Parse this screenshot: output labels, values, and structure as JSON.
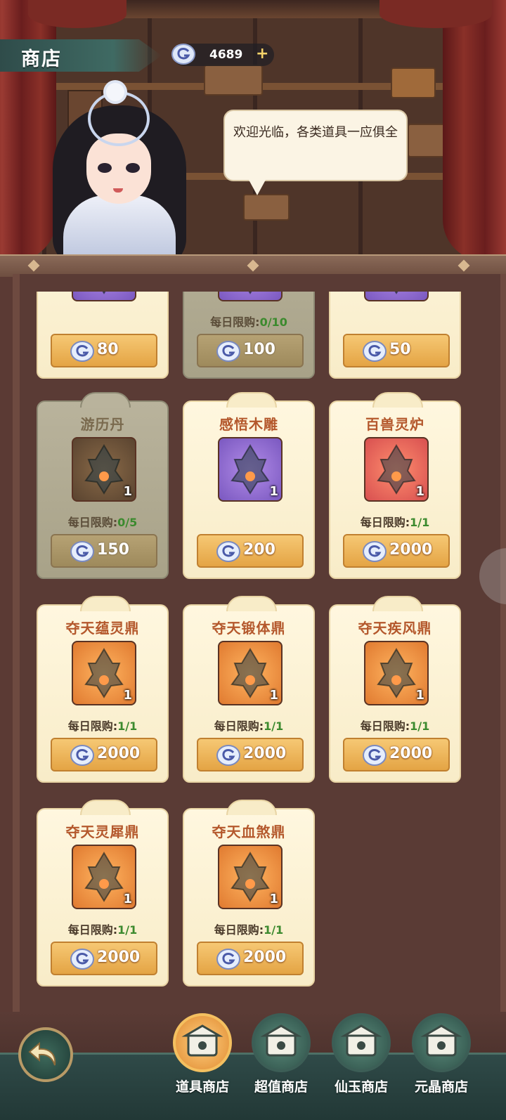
{
  "header": {
    "title": "商店",
    "currency_value": "4689",
    "currency_plus": "+",
    "currency_icon": "spirit-stone-icon"
  },
  "npc": {
    "greeting": "欢迎光临，各类道具一应俱全"
  },
  "colors": {
    "card_bg": "#f8ecc8",
    "price_bg": "#e4a444",
    "limit_green": "#3c8a2e",
    "name_orange": "#b4582c",
    "nav_bg": "#223836"
  },
  "items": [
    {
      "name": "",
      "limit_label": "",
      "limit_value": "",
      "price": "80",
      "qty": "",
      "icon": "potion-icon",
      "sold_out": false
    },
    {
      "name": "",
      "limit_label": "每日限购:",
      "limit_value": "0/10",
      "price": "100",
      "qty": "",
      "icon": "potion-icon",
      "sold_out": true
    },
    {
      "name": "",
      "limit_label": "",
      "limit_value": "",
      "price": "50",
      "qty": "",
      "icon": "potion-icon",
      "sold_out": false
    },
    {
      "name": "游历丹",
      "limit_label": "每日限购:",
      "limit_value": "0/5",
      "price": "150",
      "qty": "1",
      "icon": "pill-icon",
      "sold_out": true
    },
    {
      "name": "感悟木雕",
      "limit_label": "",
      "limit_value": "",
      "price": "200",
      "qty": "1",
      "icon": "wood-carving-icon",
      "sold_out": false
    },
    {
      "name": "百兽灵炉",
      "limit_label": "每日限购:",
      "limit_value": "1/1",
      "price": "2000",
      "qty": "1",
      "icon": "furnace-icon",
      "sold_out": false
    },
    {
      "name": "夺天蕴灵鼎",
      "limit_label": "每日限购:",
      "limit_value": "1/1",
      "price": "2000",
      "qty": "1",
      "icon": "cauldron-icon",
      "sold_out": false
    },
    {
      "name": "夺天锻体鼎",
      "limit_label": "每日限购:",
      "limit_value": "1/1",
      "price": "2000",
      "qty": "1",
      "icon": "cauldron-icon",
      "sold_out": false
    },
    {
      "name": "夺天疾风鼎",
      "limit_label": "每日限购:",
      "limit_value": "1/1",
      "price": "2000",
      "qty": "1",
      "icon": "cauldron-icon",
      "sold_out": false
    },
    {
      "name": "夺天灵犀鼎",
      "limit_label": "每日限购:",
      "limit_value": "1/1",
      "price": "2000",
      "qty": "1",
      "icon": "cauldron-icon",
      "sold_out": false
    },
    {
      "name": "夺天血煞鼎",
      "limit_label": "每日限购:",
      "limit_value": "1/1",
      "price": "2000",
      "qty": "1",
      "icon": "cauldron-icon",
      "sold_out": false
    }
  ],
  "nav": {
    "tabs": [
      {
        "label": "道具商店",
        "active": true,
        "icon": "treasure-chest-icon"
      },
      {
        "label": "超值商店",
        "active": false,
        "icon": "money-bag-icon"
      },
      {
        "label": "仙玉商店",
        "active": false,
        "icon": "pavilion-icon"
      },
      {
        "label": "元晶商店",
        "active": false,
        "icon": "shop-icon"
      }
    ],
    "back_icon": "back-arrow-icon"
  }
}
